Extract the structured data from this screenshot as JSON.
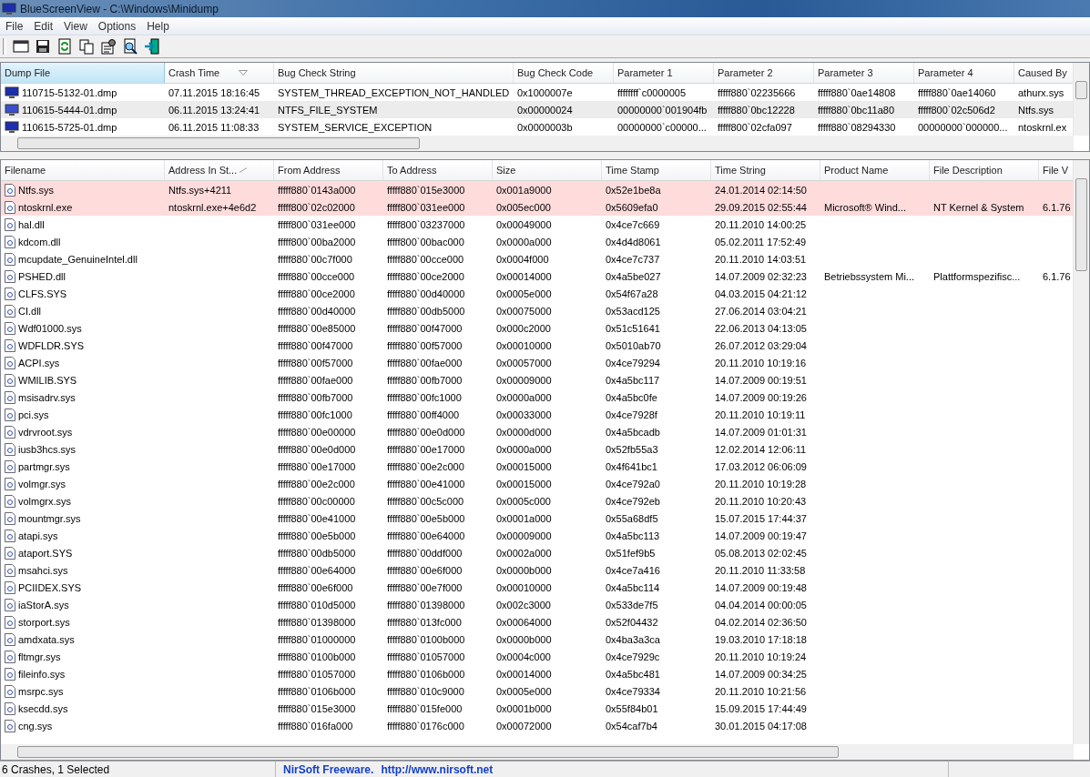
{
  "window": {
    "title": "BlueScreenView  -  C:\\Windows\\Minidump"
  },
  "menu": [
    "File",
    "Edit",
    "View",
    "Options",
    "Help"
  ],
  "dumps": {
    "columns": [
      {
        "label": "Dump File",
        "sorted": false,
        "active": true
      },
      {
        "label": "Crash Time",
        "sorted": true,
        "active": false
      },
      {
        "label": "Bug Check String",
        "sorted": false,
        "active": false
      },
      {
        "label": "Bug Check Code",
        "sorted": false,
        "active": false
      },
      {
        "label": "Parameter 1",
        "sorted": false,
        "active": false
      },
      {
        "label": "Parameter 2",
        "sorted": false,
        "active": false
      },
      {
        "label": "Parameter 3",
        "sorted": false,
        "active": false
      },
      {
        "label": "Parameter 4",
        "sorted": false,
        "active": false
      },
      {
        "label": "Caused By",
        "sorted": false,
        "active": false
      }
    ],
    "rows": [
      {
        "selected": false,
        "cells": [
          "110715-5132-01.dmp",
          "07.11.2015 18:16:45",
          "SYSTEM_THREAD_EXCEPTION_NOT_HANDLED",
          "0x1000007e",
          "ffffffff`c0000005",
          "fffff880`02235666",
          "fffff880`0ae14808",
          "fffff880`0ae14060",
          "athurx.sys"
        ]
      },
      {
        "selected": true,
        "cells": [
          "110615-5444-01.dmp",
          "06.11.2015 13:24:41",
          "NTFS_FILE_SYSTEM",
          "0x00000024",
          "00000000`001904fb",
          "fffff880`0bc12228",
          "fffff880`0bc11a80",
          "fffff800`02c506d2",
          "Ntfs.sys"
        ]
      },
      {
        "selected": false,
        "cells": [
          "110615-5725-01.dmp",
          "06.11.2015 11:08:33",
          "SYSTEM_SERVICE_EXCEPTION",
          "0x0000003b",
          "00000000`c00000...",
          "fffff800`02cfa097",
          "fffff880`08294330",
          "00000000`000000...",
          "ntoskrnl.ex"
        ]
      }
    ]
  },
  "modules": {
    "columns": [
      {
        "label": "Filename",
        "sorted": false
      },
      {
        "label": "Address In St...",
        "sorted": true
      },
      {
        "label": "From Address",
        "sorted": false
      },
      {
        "label": "To Address",
        "sorted": false
      },
      {
        "label": "Size",
        "sorted": false
      },
      {
        "label": "Time Stamp",
        "sorted": false
      },
      {
        "label": "Time String",
        "sorted": false
      },
      {
        "label": "Product Name",
        "sorted": false
      },
      {
        "label": "File Description",
        "sorted": false
      },
      {
        "label": "File V",
        "sorted": false
      }
    ],
    "rows": [
      {
        "highlighted": true,
        "filename": "Ntfs.sys",
        "address_in_stack": "Ntfs.sys+4211",
        "from": "fffff880`0143a000",
        "to": "fffff880`015e3000",
        "size": "0x001a9000",
        "time_stamp": "0x52e1be8a",
        "time_string": "24.01.2014 02:14:50"
      },
      {
        "highlighted": true,
        "filename": "ntoskrnl.exe",
        "address_in_stack": "ntoskrnl.exe+4e6d2",
        "from": "fffff800`02c02000",
        "to": "fffff800`031ee000",
        "size": "0x005ec000",
        "time_stamp": "0x5609efa0",
        "time_string": "29.09.2015 02:55:44",
        "product_name": "Microsoft® Wind...",
        "file_description": "NT Kernel & System",
        "file_version": "6.1.76"
      },
      {
        "highlighted": false,
        "filename": "hal.dll",
        "from": "fffff800`031ee000",
        "to": "fffff800`03237000",
        "size": "0x00049000",
        "time_stamp": "0x4ce7c669",
        "time_string": "20.11.2010 14:00:25"
      },
      {
        "highlighted": false,
        "filename": "kdcom.dll",
        "from": "fffff800`00ba2000",
        "to": "fffff800`00bac000",
        "size": "0x0000a000",
        "time_stamp": "0x4d4d8061",
        "time_string": "05.02.2011 17:52:49"
      },
      {
        "highlighted": false,
        "filename": "mcupdate_GenuineIntel.dll",
        "from": "fffff880`00c7f000",
        "to": "fffff880`00cce000",
        "size": "0x0004f000",
        "time_stamp": "0x4ce7c737",
        "time_string": "20.11.2010 14:03:51"
      },
      {
        "highlighted": false,
        "filename": "PSHED.dll",
        "from": "fffff880`00cce000",
        "to": "fffff880`00ce2000",
        "size": "0x00014000",
        "time_stamp": "0x4a5be027",
        "time_string": "14.07.2009 02:32:23",
        "product_name": "Betriebssystem Mi...",
        "file_description": "Plattformspezifisc...",
        "file_version": "6.1.76"
      },
      {
        "highlighted": false,
        "filename": "CLFS.SYS",
        "from": "fffff880`00ce2000",
        "to": "fffff880`00d40000",
        "size": "0x0005e000",
        "time_stamp": "0x54f67a28",
        "time_string": "04.03.2015 04:21:12"
      },
      {
        "highlighted": false,
        "filename": "CI.dll",
        "from": "fffff880`00d40000",
        "to": "fffff880`00db5000",
        "size": "0x00075000",
        "time_stamp": "0x53acd125",
        "time_string": "27.06.2014 03:04:21"
      },
      {
        "highlighted": false,
        "filename": "Wdf01000.sys",
        "from": "fffff880`00e85000",
        "to": "fffff880`00f47000",
        "size": "0x000c2000",
        "time_stamp": "0x51c51641",
        "time_string": "22.06.2013 04:13:05"
      },
      {
        "highlighted": false,
        "filename": "WDFLDR.SYS",
        "from": "fffff880`00f47000",
        "to": "fffff880`00f57000",
        "size": "0x00010000",
        "time_stamp": "0x5010ab70",
        "time_string": "26.07.2012 03:29:04"
      },
      {
        "highlighted": false,
        "filename": "ACPI.sys",
        "from": "fffff880`00f57000",
        "to": "fffff880`00fae000",
        "size": "0x00057000",
        "time_stamp": "0x4ce79294",
        "time_string": "20.11.2010 10:19:16"
      },
      {
        "highlighted": false,
        "filename": "WMILIB.SYS",
        "from": "fffff880`00fae000",
        "to": "fffff880`00fb7000",
        "size": "0x00009000",
        "time_stamp": "0x4a5bc117",
        "time_string": "14.07.2009 00:19:51"
      },
      {
        "highlighted": false,
        "filename": "msisadrv.sys",
        "from": "fffff880`00fb7000",
        "to": "fffff880`00fc1000",
        "size": "0x0000a000",
        "time_stamp": "0x4a5bc0fe",
        "time_string": "14.07.2009 00:19:26"
      },
      {
        "highlighted": false,
        "filename": "pci.sys",
        "from": "fffff880`00fc1000",
        "to": "fffff880`00ff4000",
        "size": "0x00033000",
        "time_stamp": "0x4ce7928f",
        "time_string": "20.11.2010 10:19:11"
      },
      {
        "highlighted": false,
        "filename": "vdrvroot.sys",
        "from": "fffff880`00e00000",
        "to": "fffff880`00e0d000",
        "size": "0x0000d000",
        "time_stamp": "0x4a5bcadb",
        "time_string": "14.07.2009 01:01:31"
      },
      {
        "highlighted": false,
        "filename": "iusb3hcs.sys",
        "from": "fffff880`00e0d000",
        "to": "fffff880`00e17000",
        "size": "0x0000a000",
        "time_stamp": "0x52fb55a3",
        "time_string": "12.02.2014 12:06:11"
      },
      {
        "highlighted": false,
        "filename": "partmgr.sys",
        "from": "fffff880`00e17000",
        "to": "fffff880`00e2c000",
        "size": "0x00015000",
        "time_stamp": "0x4f641bc1",
        "time_string": "17.03.2012 06:06:09"
      },
      {
        "highlighted": false,
        "filename": "volmgr.sys",
        "from": "fffff880`00e2c000",
        "to": "fffff880`00e41000",
        "size": "0x00015000",
        "time_stamp": "0x4ce792a0",
        "time_string": "20.11.2010 10:19:28"
      },
      {
        "highlighted": false,
        "filename": "volmgrx.sys",
        "from": "fffff880`00c00000",
        "to": "fffff880`00c5c000",
        "size": "0x0005c000",
        "time_stamp": "0x4ce792eb",
        "time_string": "20.11.2010 10:20:43"
      },
      {
        "highlighted": false,
        "filename": "mountmgr.sys",
        "from": "fffff880`00e41000",
        "to": "fffff880`00e5b000",
        "size": "0x0001a000",
        "time_stamp": "0x55a68df5",
        "time_string": "15.07.2015 17:44:37"
      },
      {
        "highlighted": false,
        "filename": "atapi.sys",
        "from": "fffff880`00e5b000",
        "to": "fffff880`00e64000",
        "size": "0x00009000",
        "time_stamp": "0x4a5bc113",
        "time_string": "14.07.2009 00:19:47"
      },
      {
        "highlighted": false,
        "filename": "ataport.SYS",
        "from": "fffff880`00db5000",
        "to": "fffff880`00ddf000",
        "size": "0x0002a000",
        "time_stamp": "0x51fef9b5",
        "time_string": "05.08.2013 02:02:45"
      },
      {
        "highlighted": false,
        "filename": "msahci.sys",
        "from": "fffff880`00e64000",
        "to": "fffff880`00e6f000",
        "size": "0x0000b000",
        "time_stamp": "0x4ce7a416",
        "time_string": "20.11.2010 11:33:58"
      },
      {
        "highlighted": false,
        "filename": "PCIIDEX.SYS",
        "from": "fffff880`00e6f000",
        "to": "fffff880`00e7f000",
        "size": "0x00010000",
        "time_stamp": "0x4a5bc114",
        "time_string": "14.07.2009 00:19:48"
      },
      {
        "highlighted": false,
        "filename": "iaStorA.sys",
        "from": "fffff880`010d5000",
        "to": "fffff880`01398000",
        "size": "0x002c3000",
        "time_stamp": "0x533de7f5",
        "time_string": "04.04.2014 00:00:05"
      },
      {
        "highlighted": false,
        "filename": "storport.sys",
        "from": "fffff880`01398000",
        "to": "fffff880`013fc000",
        "size": "0x00064000",
        "time_stamp": "0x52f04432",
        "time_string": "04.02.2014 02:36:50"
      },
      {
        "highlighted": false,
        "filename": "amdxata.sys",
        "from": "fffff880`01000000",
        "to": "fffff880`0100b000",
        "size": "0x0000b000",
        "time_stamp": "0x4ba3a3ca",
        "time_string": "19.03.2010 17:18:18"
      },
      {
        "highlighted": false,
        "filename": "fltmgr.sys",
        "from": "fffff880`0100b000",
        "to": "fffff880`01057000",
        "size": "0x0004c000",
        "time_stamp": "0x4ce7929c",
        "time_string": "20.11.2010 10:19:24"
      },
      {
        "highlighted": false,
        "filename": "fileinfo.sys",
        "from": "fffff880`01057000",
        "to": "fffff880`0106b000",
        "size": "0x00014000",
        "time_stamp": "0x4a5bc481",
        "time_string": "14.07.2009 00:34:25"
      },
      {
        "highlighted": false,
        "filename": "msrpc.sys",
        "from": "fffff880`0106b000",
        "to": "fffff880`010c9000",
        "size": "0x0005e000",
        "time_stamp": "0x4ce79334",
        "time_string": "20.11.2010 10:21:56"
      },
      {
        "highlighted": false,
        "filename": "ksecdd.sys",
        "from": "fffff880`015e3000",
        "to": "fffff880`015fe000",
        "size": "0x0001b000",
        "time_stamp": "0x55f84b01",
        "time_string": "15.09.2015 17:44:49"
      },
      {
        "highlighted": false,
        "filename": "cng.sys",
        "from": "fffff880`016fa000",
        "to": "fffff880`0176c000",
        "size": "0x00072000",
        "time_stamp": "0x54caf7b4",
        "time_string": "30.01.2015 04:17:08"
      }
    ]
  },
  "status_bar": {
    "count": "6 Crashes, 1 Selected",
    "credit": "NirSoft Freeware.",
    "link": "http://www.nirsoft.net"
  }
}
